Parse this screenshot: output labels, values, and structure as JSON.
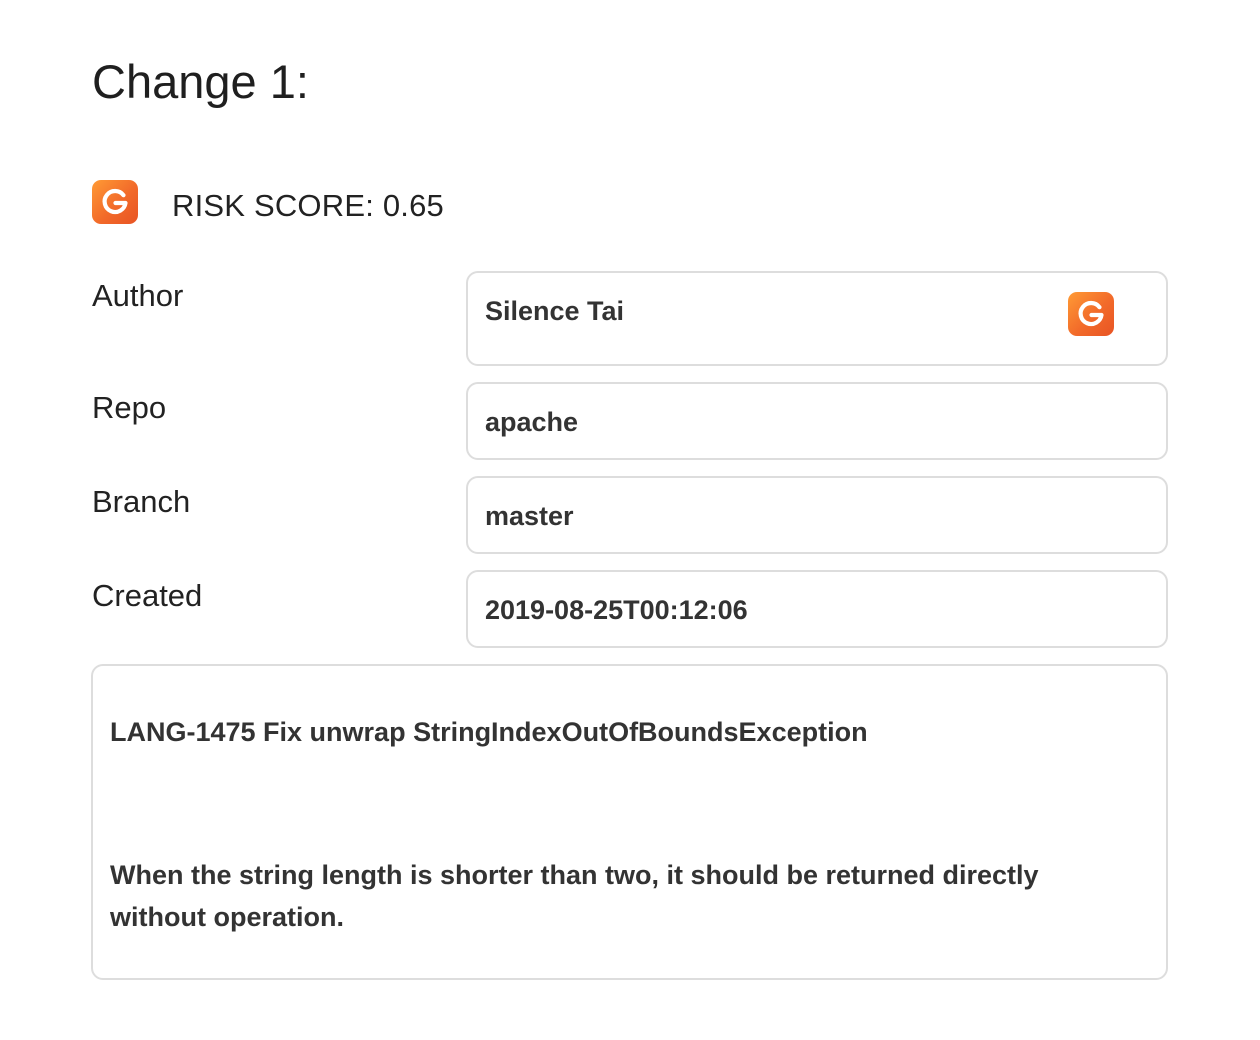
{
  "page": {
    "title": "Change 1:"
  },
  "risk": {
    "label": "RISK SCORE: 0.65",
    "score": 0.65,
    "logo_icon": "g-logo-icon",
    "logo_colors": [
      "#ff9b35",
      "#e85424"
    ]
  },
  "fields": {
    "author": {
      "label": "Author",
      "value": "Silence Tai",
      "icon": "g-logo-icon"
    },
    "repo": {
      "label": "Repo",
      "value": "apache"
    },
    "branch": {
      "label": "Branch",
      "value": "master"
    },
    "created": {
      "label": "Created",
      "value": "2019-08-25T00:12:06"
    }
  },
  "description": {
    "title": "LANG-1475 Fix unwrap StringIndexOutOfBoundsException",
    "body": "When the string length is shorter than two, it should be returned directly without operation."
  }
}
